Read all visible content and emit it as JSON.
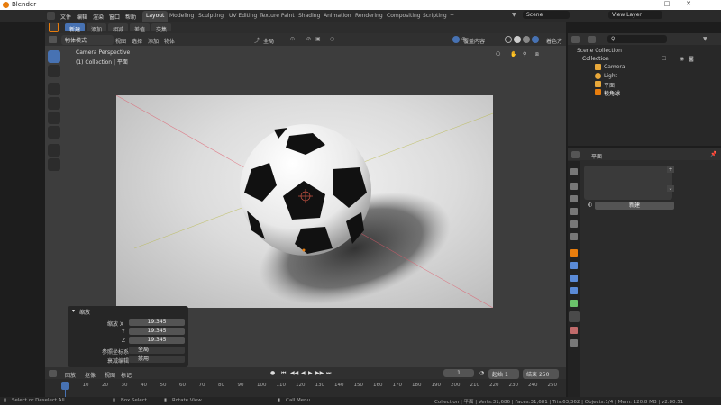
{
  "window": {
    "title": "Blender",
    "controls": [
      "—",
      "□",
      "✕"
    ]
  },
  "menu": [
    "文件",
    "编辑",
    "渲染",
    "窗口",
    "帮助"
  ],
  "workspaces": [
    "Layout",
    "Modeling",
    "Sculpting",
    "UV Editing",
    "Texture Paint",
    "Shading",
    "Animation",
    "Rendering",
    "Compositing",
    "Scripting",
    "+"
  ],
  "scene": {
    "label": "Scene",
    "view_layer": "View Layer"
  },
  "tool_header": {
    "buttons": [
      "新建",
      "添加",
      "相减",
      "差值",
      "交集"
    ]
  },
  "viewport_header": {
    "mode": "物体模式",
    "menus": [
      "视图",
      "选择",
      "添加",
      "物体"
    ],
    "orientation": "全局",
    "overlay": "覆盖内容",
    "shading_popover": "着色方式"
  },
  "viewport": {
    "name": "Camera Perspective",
    "collection": "(1) Collection | 平面"
  },
  "operator_panel": {
    "title": "缩放",
    "scale_label_x": "缩放 X",
    "label_y": "Y",
    "label_z": "Z",
    "x": "19.345",
    "y": "19.345",
    "z": "19.345",
    "orient_label": "参照坐标系",
    "orient_value": "全局",
    "prop_edit_label": "衰减编辑",
    "prop_edit_value": "禁用"
  },
  "timeline": {
    "menus": [
      "回放",
      "抠像",
      "视图",
      "标记"
    ],
    "current_frame": "1",
    "start_label": "起始",
    "start": "1",
    "end_label": "结束",
    "end": "250",
    "ticks": [
      "0",
      "10",
      "20",
      "30",
      "40",
      "50",
      "60",
      "70",
      "80",
      "90",
      "100",
      "110",
      "120",
      "130",
      "140",
      "150",
      "160",
      "170",
      "180",
      "190",
      "200",
      "210",
      "220",
      "230",
      "240",
      "250"
    ]
  },
  "status": {
    "select": "Select or Deselect All",
    "box": "Box Select",
    "rotate": "Rotate View",
    "call": "Call Menu",
    "stats": "Collection | 平面 | Verts:31,686 | Faces:31,681 | Tris:63,362 | Objects:1/4 | Mem: 120.8 MB | v2.80.51"
  },
  "outliner": {
    "root": "Scene Collection",
    "collection": "Collection",
    "items": [
      {
        "name": "Camera",
        "color": "#e8a83a"
      },
      {
        "name": "Light",
        "color": "#e8a83a"
      },
      {
        "name": "平面",
        "color": "#e8a83a"
      },
      {
        "name": "棱角球",
        "color": "#e8a83a"
      }
    ]
  },
  "properties": {
    "object": "平面",
    "new_label": "新建"
  },
  "colors": {
    "accent": "#4772b3",
    "selected_orange": "#e87d0d"
  }
}
